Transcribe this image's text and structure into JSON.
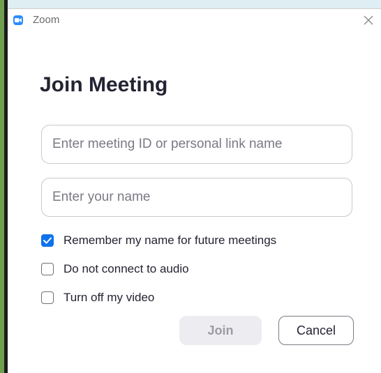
{
  "window": {
    "title": "Zoom",
    "logo_icon": "zoom-camera-icon",
    "close_icon": "close-icon"
  },
  "page": {
    "title": "Join Meeting"
  },
  "inputs": {
    "meeting_id": {
      "value": "",
      "placeholder": "Enter meeting ID or personal link name"
    },
    "your_name": {
      "value": "",
      "placeholder": "Enter your name"
    }
  },
  "options": [
    {
      "label": "Remember my name for future meetings",
      "checked": true
    },
    {
      "label": "Do not connect to audio",
      "checked": false
    },
    {
      "label": "Turn off my video",
      "checked": false
    }
  ],
  "buttons": {
    "join_label": "Join",
    "join_enabled": false,
    "cancel_label": "Cancel"
  },
  "colors": {
    "accent": "#0e72ed",
    "logo_blue": "#2d8cff",
    "text_primary": "#232333"
  }
}
